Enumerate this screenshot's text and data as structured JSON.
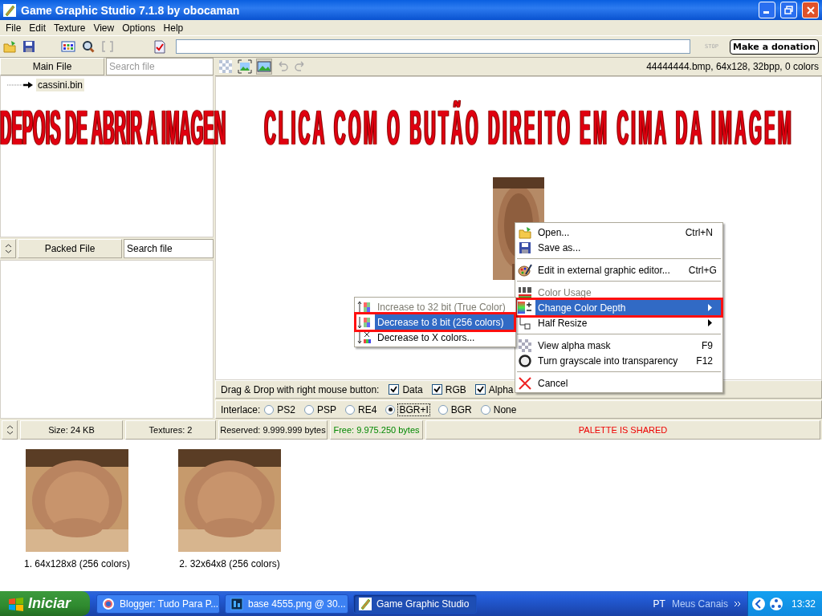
{
  "window": {
    "title": "Game Graphic Studio 7.1.8 by obocaman"
  },
  "menu_bar": [
    "File",
    "Edit",
    "Texture",
    "View",
    "Options",
    "Help"
  ],
  "toolbar": {
    "stop": "STOP",
    "donate": "Make a donation"
  },
  "main_file": {
    "button": "Main File",
    "search_placeholder": "Search file",
    "tree": [
      {
        "label": "cassini.bin",
        "selected": true
      }
    ]
  },
  "packed_file": {
    "button": "Packed File",
    "search_value": "Search file"
  },
  "image_panel": {
    "info": "44444444.bmp, 64x128, 32bpp, 0 colors"
  },
  "drag_drop": {
    "label": "Drag & Drop with right mouse button:",
    "options": [
      {
        "label": "Data",
        "checked": true
      },
      {
        "label": "RGB",
        "checked": true
      },
      {
        "label": "Alpha",
        "checked": true
      }
    ]
  },
  "interlace": {
    "label": "Interlace:",
    "options": [
      {
        "label": "PS2",
        "selected": false
      },
      {
        "label": "PSP",
        "selected": false
      },
      {
        "label": "RE4",
        "selected": false
      },
      {
        "label": "BGR+I",
        "selected": true
      },
      {
        "label": "BGR",
        "selected": false
      },
      {
        "label": "None",
        "selected": false
      }
    ]
  },
  "status_bar": {
    "size": "Size: 24 KB",
    "textures": "Textures: 2",
    "reserved": "Reserved: 9.999.999 bytes",
    "free": "Free: 9.975.250 bytes",
    "palette": "PALETTE IS SHARED"
  },
  "thumbnails": [
    {
      "kind": "picture",
      "label": "1. 64x128x8 (256 colors)"
    },
    {
      "kind": "picture",
      "label": "2. 32x64x8 (256 colors)"
    }
  ],
  "annotation": {
    "banner": [
      "DEPOIS DE ABRIR A IMAGEN",
      "CLICA COM O BUTÃO DIREITO EM CIMA DA IMAGEM"
    ]
  },
  "context_menu": {
    "items": [
      {
        "kind": "item",
        "label": "Open...",
        "shortcut": "Ctrl+N",
        "disabled": false,
        "selected": false,
        "submenu": false
      },
      {
        "kind": "item",
        "label": "Save as...",
        "disabled": false,
        "selected": false,
        "submenu": false
      },
      {
        "kind": "separator"
      },
      {
        "kind": "item",
        "label": "Edit in external graphic editor...",
        "shortcut": "Ctrl+G",
        "disabled": false,
        "selected": false,
        "submenu": false
      },
      {
        "kind": "separator"
      },
      {
        "kind": "item",
        "label": "Color Usage",
        "disabled": true,
        "selected": false,
        "submenu": false
      },
      {
        "kind": "item",
        "label": "Change Color Depth",
        "disabled": false,
        "selected": true,
        "submenu": true
      },
      {
        "kind": "item",
        "label": "Half Resize",
        "disabled": false,
        "selected": false,
        "submenu": true
      },
      {
        "kind": "separator"
      },
      {
        "kind": "item",
        "label": "View alpha mask",
        "shortcut": "F9",
        "disabled": false,
        "selected": false,
        "submenu": false
      },
      {
        "kind": "item",
        "label": "Turn grayscale into transparency",
        "shortcut": "F12",
        "disabled": false,
        "selected": false,
        "submenu": false
      },
      {
        "kind": "separator"
      },
      {
        "kind": "item",
        "label": "Cancel",
        "disabled": false,
        "selected": false,
        "submenu": false
      }
    ]
  },
  "submenu": {
    "items": [
      {
        "kind": "item",
        "label": "Increase to 32 bit (True Color)",
        "disabled": true,
        "selected": false,
        "submenu": false
      },
      {
        "kind": "item",
        "label": "Decrease to 8 bit (256 colors)",
        "disabled": false,
        "selected": true,
        "submenu": false
      },
      {
        "kind": "item",
        "label": "Decrease to X colors...",
        "disabled": false,
        "selected": false,
        "submenu": false
      }
    ]
  },
  "taskbar": {
    "start": "Iniciar",
    "tasks": [
      {
        "label": "Blogger: Tudo Para P...",
        "selected": false
      },
      {
        "label": "base 4555.png @ 30...",
        "selected": false
      },
      {
        "label": "Game Graphic Studio",
        "selected": true
      }
    ],
    "language": "PT",
    "toolbar_label": "Meus Canais",
    "clock": "13:32"
  }
}
